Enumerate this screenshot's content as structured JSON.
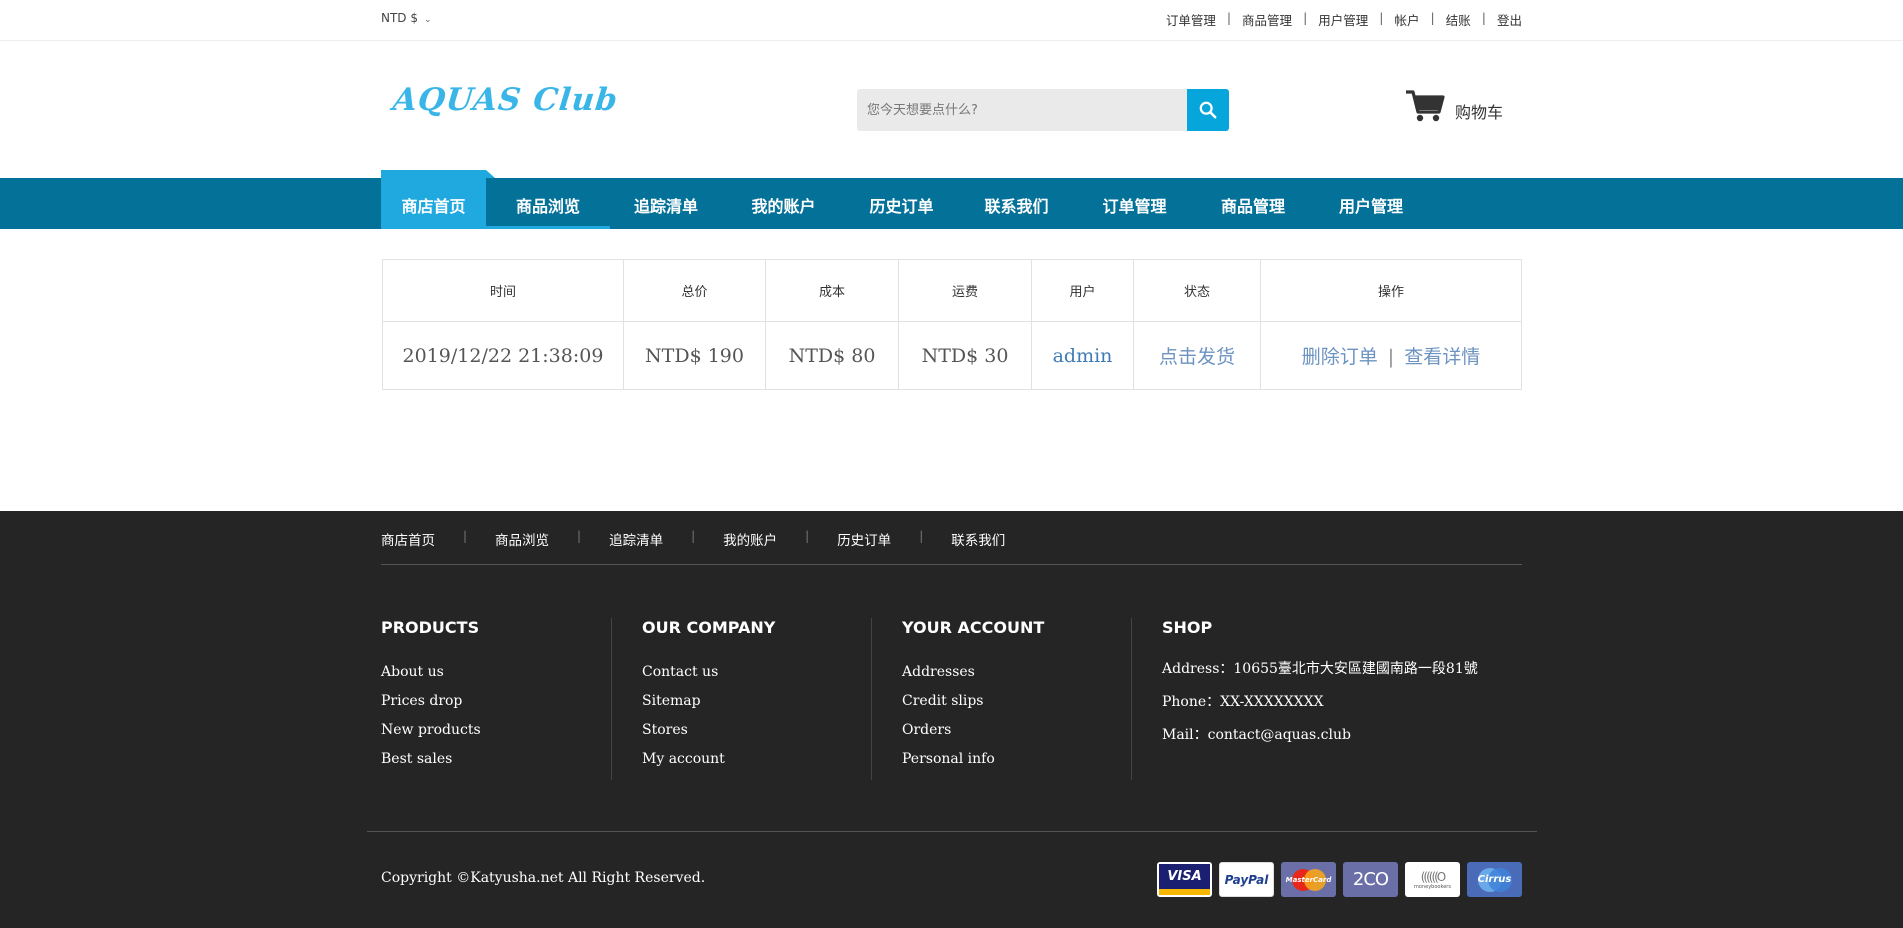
{
  "topbar": {
    "currency": "NTD $",
    "links": [
      "订单管理",
      "商品管理",
      "用户管理",
      "帐户",
      "结账",
      "登出"
    ],
    "separator": "|"
  },
  "header": {
    "logo": "AQUAS Club",
    "search_placeholder": "您今天想要点什么?",
    "cart_label": "购物车"
  },
  "nav": {
    "items": [
      "商店首页",
      "商品浏览",
      "追踪清单",
      "我的账户",
      "历史订单",
      "联系我们",
      "订单管理",
      "商品管理",
      "用户管理"
    ],
    "active_index": 0
  },
  "orders": {
    "headers": [
      "时间",
      "总价",
      "成本",
      "运费",
      "用户",
      "状态",
      "操作"
    ],
    "rows": [
      {
        "time": "2019/12/22 21:38:09",
        "total": "NTD$ 190",
        "cost": "NTD$ 80",
        "shipping": "NTD$ 30",
        "user": "admin",
        "status": "点击发货",
        "action_delete": "删除订单",
        "action_sep": "|",
        "action_view": "查看详情"
      }
    ]
  },
  "footer": {
    "links": [
      "商店首页",
      "商品浏览",
      "追踪清单",
      "我的账户",
      "历史订单",
      "联系我们"
    ],
    "columns": [
      {
        "title": "PRODUCTS",
        "items": [
          "About us",
          "Prices drop",
          "New products",
          "Best sales"
        ]
      },
      {
        "title": "OUR COMPANY",
        "items": [
          "Contact us",
          "Sitemap",
          "Stores",
          "My account"
        ]
      },
      {
        "title": "YOUR ACCOUNT",
        "items": [
          "Addresses",
          "Credit slips",
          "Orders",
          "Personal info"
        ]
      },
      {
        "title": "SHOP",
        "items": [
          "Address：10655臺北市大安區建國南路一段81號",
          "Phone：XX-XXXXXXXX",
          "Mail：contact@aquas.club"
        ]
      }
    ],
    "copyright": "Copyright ©Katyusha.net All Right Reserved.",
    "payments": [
      {
        "name": "VISA",
        "bg": "#1a1f71",
        "fg": "#ffffff"
      },
      {
        "name": "PayPal",
        "bg": "#ffffff",
        "fg": "#1f3f8f"
      },
      {
        "name": "MasterCard",
        "bg": "#6b6fa8",
        "fg": "#f7a51a"
      },
      {
        "name": "2CO",
        "bg": "#6b6fa8",
        "fg": "#ffffff"
      },
      {
        "name": "moneybookers",
        "bg": "#ffffff",
        "fg": "#555555"
      },
      {
        "name": "Cirrus",
        "bg": "#4a6cb8",
        "fg": "#ffffff"
      }
    ]
  },
  "colors": {
    "nav_bg": "#047199",
    "nav_active": "#20a9de",
    "search_button": "#06a6dc",
    "logo": "#39b5e7",
    "footer_bg": "#252525",
    "link": "#3f7bb6"
  }
}
